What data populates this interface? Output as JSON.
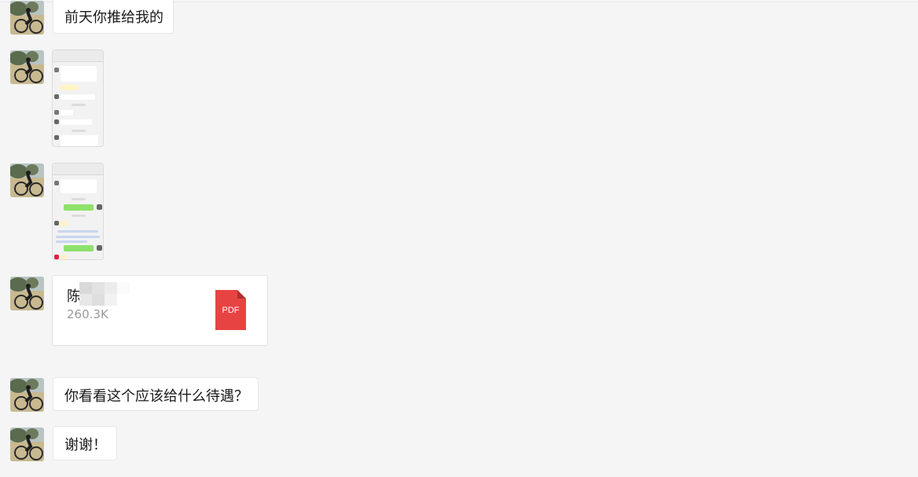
{
  "messages": [
    {
      "type": "text",
      "text": "前天你推给我的"
    },
    {
      "type": "image",
      "alt": "screenshot"
    },
    {
      "type": "image",
      "alt": "screenshot"
    },
    {
      "type": "file",
      "name": "陈",
      "size": "260.3K",
      "badge": "PDF"
    },
    {
      "type": "text",
      "text": "你看看这个应该给什么待遇？"
    },
    {
      "type": "text",
      "text": "谢谢！"
    }
  ],
  "colors": {
    "background": "#f5f5f5",
    "bubble": "#ffffff",
    "pdf_red": "#e84343",
    "green_bubble": "#8ee26b"
  }
}
